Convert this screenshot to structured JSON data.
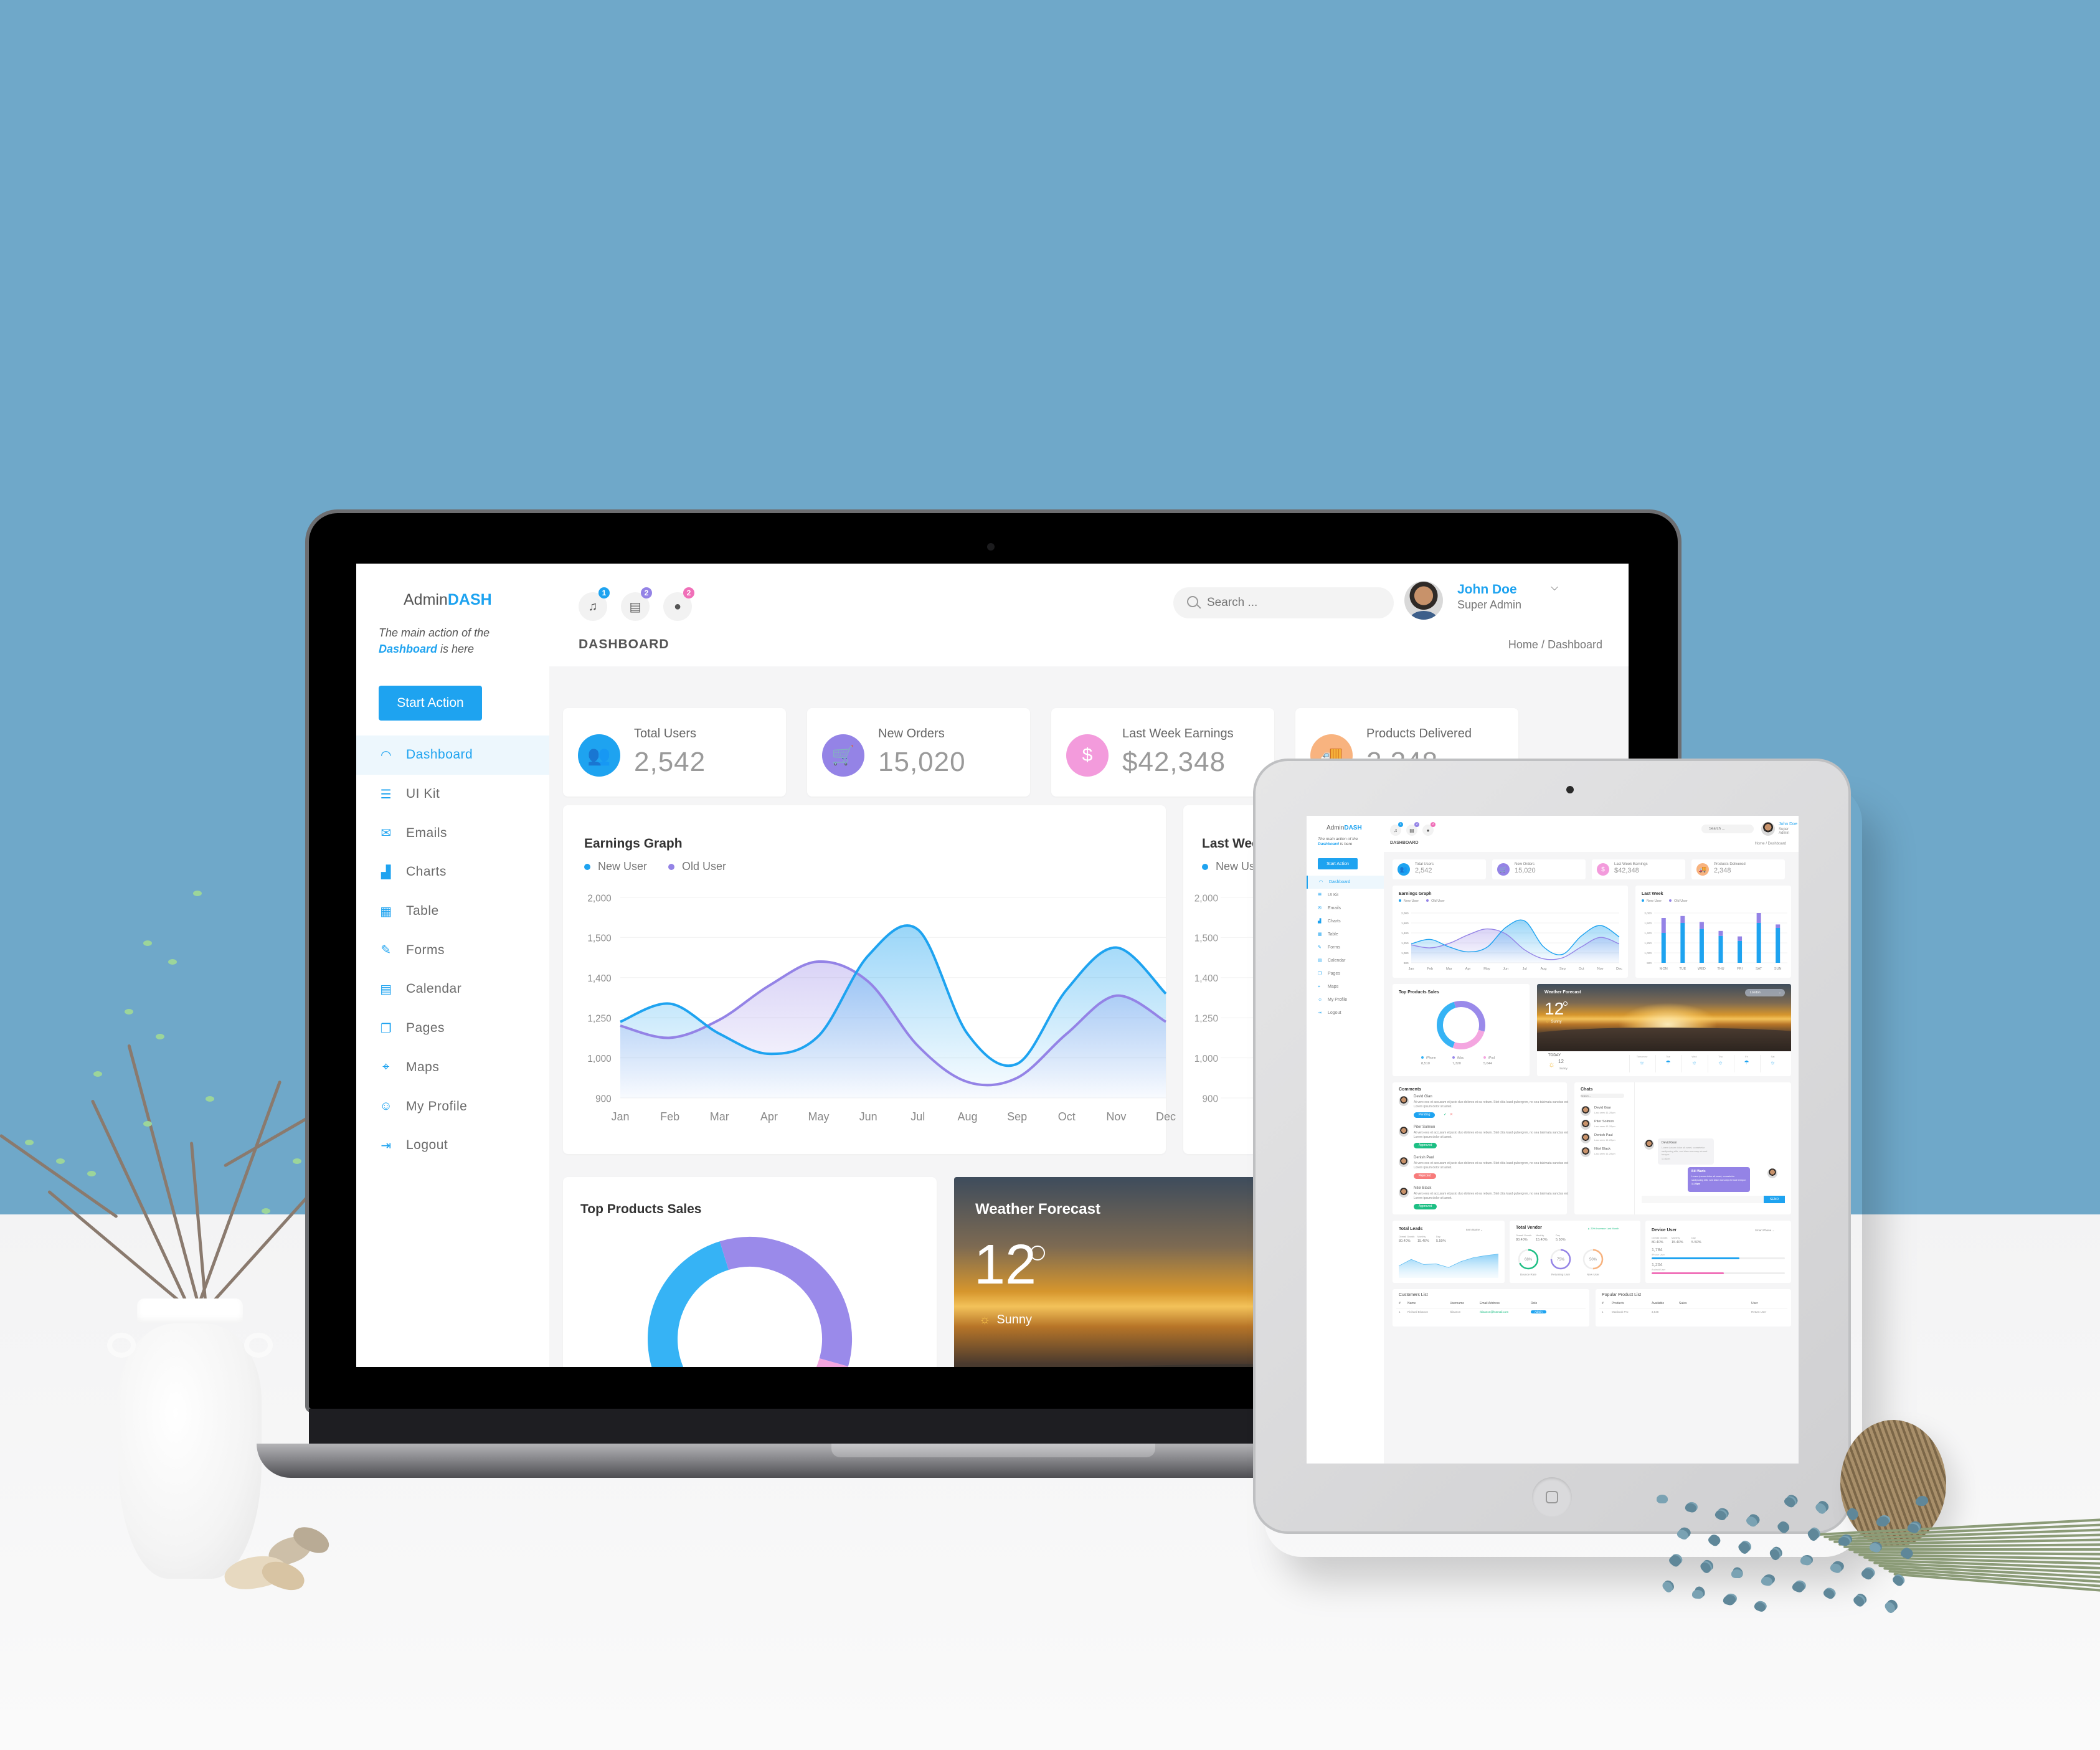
{
  "colors": {
    "accent": "#1ea3f0",
    "purple": "#9483e6",
    "pink": "#f39bdc",
    "orange": "#f8b37f",
    "green": "#1dbf84",
    "red": "#f77b7b",
    "wall": "#6fa8c9"
  },
  "app": {
    "logo_prefix": "Admin",
    "logo_suffix": "DASH",
    "tagline_part1": "The main action of the",
    "tagline_highlight": "Dashboard",
    "tagline_part2": " is here",
    "start_action_label": "Start Action"
  },
  "sidebar": {
    "items": [
      {
        "label": "Dashboard",
        "icon": "speedometer-icon",
        "glyph": "◠",
        "active": true
      },
      {
        "label": "UI Kit",
        "icon": "list-icon",
        "glyph": "☰"
      },
      {
        "label": "Emails",
        "icon": "envelope-icon",
        "glyph": "✉"
      },
      {
        "label": "Charts",
        "icon": "bar-chart-icon",
        "glyph": "▟"
      },
      {
        "label": "Table",
        "icon": "table-icon",
        "glyph": "▦"
      },
      {
        "label": "Forms",
        "icon": "form-edit-icon",
        "glyph": "✎"
      },
      {
        "label": "Calendar",
        "icon": "calendar-icon",
        "glyph": "▤"
      },
      {
        "label": "Pages",
        "icon": "page-icon",
        "glyph": "❐"
      },
      {
        "label": "Maps",
        "icon": "map-pin-icon",
        "glyph": "⌖"
      },
      {
        "label": "My Profile",
        "icon": "user-icon",
        "glyph": "☺"
      },
      {
        "label": "Logout",
        "icon": "logout-icon",
        "glyph": "⇥"
      }
    ]
  },
  "header": {
    "notifications": [
      {
        "icon": "bell-icon",
        "glyph": "♫",
        "count": "1",
        "color": "#1ea3f0"
      },
      {
        "icon": "message-icon",
        "glyph": "▤",
        "count": "2",
        "color": "#9483e6"
      },
      {
        "icon": "user-request-icon",
        "glyph": "●",
        "count": "2",
        "color": "#f06fb8"
      }
    ],
    "page_title": "DASHBOARD",
    "search_placeholder": "Search ...",
    "user_name": "John Doe",
    "user_role": "Super Admin",
    "breadcrumb": "Home / Dashboard"
  },
  "stats": [
    {
      "label": "Total Users",
      "value": "2,542",
      "icon": "users-icon",
      "glyph": "👥",
      "color": "#1ea3f0"
    },
    {
      "label": "New Orders",
      "value": "15,020",
      "icon": "cart-icon",
      "glyph": "🛒",
      "color": "#9483e6"
    },
    {
      "label": "Last Week Earnings",
      "value": "$42,348",
      "icon": "dollar-icon",
      "glyph": "$",
      "color": "#f39bdc"
    },
    {
      "label": "Products Delivered",
      "value": "2,348",
      "icon": "delivery-truck-icon",
      "glyph": "🚚",
      "color": "#f8b37f"
    }
  ],
  "earnings": {
    "title": "Earnings Graph",
    "legend_new": "New User",
    "legend_old": "Old User"
  },
  "last_week": {
    "title": "Last Week",
    "legend_new": "New User",
    "legend_old": "Old User"
  },
  "top_products": {
    "title": "Top Products Sales",
    "items": [
      {
        "name": "iPhone",
        "value": "8,510",
        "color": "#36b3f5"
      },
      {
        "name": "iMac",
        "value": "7,320",
        "color": "#9a8aea"
      },
      {
        "name": "iPod",
        "value": "5,644",
        "color": "#f4a6e0"
      }
    ]
  },
  "weather": {
    "title": "Weather Forecast",
    "temp": "12",
    "condition": "Sunny",
    "city": "London",
    "today_label": "TODAY",
    "today_temp": "12",
    "today_cond": "Sunny",
    "days": [
      {
        "label": "Tomorrow",
        "icon": "sun-icon",
        "glyph": "☼"
      },
      {
        "label": "Tue",
        "icon": "cloud-rain-icon",
        "glyph": "☂"
      },
      {
        "label": "Wed",
        "icon": "sun-icon",
        "glyph": "☼"
      },
      {
        "label": "Thu",
        "icon": "sun-icon",
        "glyph": "☼"
      },
      {
        "label": "Fri",
        "icon": "cloud-rain-icon",
        "glyph": "☂"
      },
      {
        "label": "Sat",
        "icon": "sun-icon",
        "glyph": "☼"
      }
    ]
  },
  "comments": {
    "title": "Comments",
    "items": [
      {
        "name": "Devid Gian",
        "text": "At vero eos et accusam et justo duo dolores et ea rebum. Stet clita kasd gubergren, no sea takimata sanctus est Lorem ipsum dolor sit amet.",
        "status": "Pending",
        "status_color": "#1ea3f0",
        "actions": true
      },
      {
        "name": "Piter Solmon",
        "text": "At vero eos et accusam et justo duo dolores et ea rebum. Stet clita kasd gubergren, no sea takimata sanctus est Lorem ipsum dolor sit amet.",
        "status": "Approved",
        "status_color": "#1dbf84"
      },
      {
        "name": "Denish Paul",
        "text": "At vero eos et accusam et justo duo dolores et ea rebum. Stet clita kasd gubergren, no sea takimata sanctus est Lorem ipsum dolor sit amet.",
        "status": "Rejected",
        "status_color": "#f77b7b"
      },
      {
        "name": "Nitel Black",
        "text": "At vero eos et accusam et justo duo dolores et ea rebum. Stet clita kasd gubergren, no sea takimata sanctus est Lorem ipsum dolor sit amet.",
        "status": "Approved",
        "status_color": "#1dbf84"
      }
    ]
  },
  "chats": {
    "title": "Chats",
    "search_placeholder": "Search ...",
    "contacts": [
      {
        "name": "Devid Gian",
        "seen": "Last seen 11:28pm"
      },
      {
        "name": "Piter Solmon",
        "seen": "Last seen 11:28pm"
      },
      {
        "name": "Denish Paul",
        "seen": "Last seen 11:28pm"
      },
      {
        "name": "Nitel Black",
        "seen": "Last seen 11:28pm"
      }
    ],
    "messages": [
      {
        "from": "Devid Gian",
        "text": "Lorem ipsum dolor sit amet, consetetur sadipscing elitr, sed diam nonumy eirmod tempor.",
        "time": "11:40pm"
      },
      {
        "from": "Bill Waris",
        "text": "Lorem ipsum dolor sit amet, consetetur sadipscing elitr, sed diam nonumy eirmod tempor.",
        "time": "11:28pm"
      }
    ],
    "send_label": "SEND"
  },
  "total_leads": {
    "title": "Total Leads",
    "dropdown": "Item Name",
    "metrics": [
      {
        "label": "Overall Growth",
        "value": "80.40%"
      },
      {
        "label": "Monthly",
        "value": "15.40%"
      },
      {
        "label": "Day",
        "value": "5.50%"
      }
    ]
  },
  "total_vendor": {
    "title": "Total Vendor",
    "trend": "▲ 20% Increase Last Month",
    "metrics": [
      {
        "label": "Overall Growth",
        "value": "80.40%"
      },
      {
        "label": "Monthly",
        "value": "15.40%"
      },
      {
        "label": "Day",
        "value": "5.50%"
      }
    ],
    "rings": [
      {
        "label": "Bounce Rate",
        "percent": 68,
        "text": "68%",
        "color": "#1dbf84"
      },
      {
        "label": "Returning User",
        "percent": 75,
        "text": "75%",
        "color": "#9483e6"
      },
      {
        "label": "New User",
        "percent": 50,
        "text": "50%",
        "color": "#f8b37f"
      }
    ]
  },
  "device_user": {
    "title": "Device User",
    "dropdown": "Smart Phone",
    "metrics": [
      {
        "label": "Overall Growth",
        "value": "80.40%"
      },
      {
        "label": "Monthly",
        "value": "15.40%"
      },
      {
        "label": "Day",
        "value": "5.50%"
      }
    ],
    "bars": [
      {
        "value": "1,784",
        "label": "iPhone User",
        "fraction": 0.66,
        "color": "#1ea3f0"
      },
      {
        "value": "1,204",
        "label": "Android User",
        "fraction": 0.54,
        "color": "#f06fb8"
      }
    ]
  },
  "customers": {
    "title": "Customers List",
    "columns": [
      "#",
      "Name",
      "Username",
      "Email Address",
      "Role"
    ],
    "rows": [
      [
        "1",
        "Richard Bisanon",
        "rbisanon",
        "rbisanon@hotmail.com",
        "Admin"
      ]
    ]
  },
  "popular_products": {
    "title": "Popular Product List",
    "columns": [
      "#",
      "Products",
      "Available",
      "Sales",
      "User"
    ],
    "rows": [
      [
        "1",
        "Macbook Pro",
        "3,548",
        "",
        "Return User"
      ]
    ]
  },
  "chart_data": [
    {
      "type": "area",
      "title": "Earnings Graph",
      "categories": [
        "Jan",
        "Feb",
        "Mar",
        "Apr",
        "May",
        "Jun",
        "Jul",
        "Aug",
        "Sep",
        "Oct",
        "Nov",
        "Dec"
      ],
      "y_tick_labels": [
        "900",
        "1,000",
        "1,250",
        "1,400",
        "1,500",
        "2,000"
      ],
      "y_note": "tick labels are evenly spaced (non-linear); values below are expressed in tick-index units 0..5",
      "series": [
        {
          "name": "New User",
          "color": "#1ea3f0",
          "values": [
            1.9,
            2.35,
            1.6,
            1.1,
            1.55,
            3.55,
            4.2,
            1.6,
            0.85,
            2.7,
            3.75,
            2.6
          ]
        },
        {
          "name": "Old User",
          "color": "#9483e6",
          "values": [
            1.8,
            1.5,
            1.95,
            2.8,
            3.4,
            2.9,
            1.3,
            0.4,
            0.5,
            1.6,
            2.55,
            1.9
          ]
        }
      ],
      "ylim": [
        0,
        5
      ],
      "legend": "top-left",
      "grid": true
    },
    {
      "type": "bar",
      "title": "Last Week",
      "stacked": true,
      "categories": [
        "MON",
        "TUE",
        "WED",
        "THU",
        "FRI",
        "SAT",
        "SUN"
      ],
      "y_tick_labels": [
        "900",
        "1,000",
        "1,250",
        "1,400",
        "1,500",
        "2,000"
      ],
      "series": [
        {
          "name": "New User",
          "color": "#1ea3f0",
          "values": [
            3.0,
            4.0,
            3.4,
            2.7,
            2.2,
            4.0,
            3.5
          ]
        },
        {
          "name": "Old User",
          "color": "#9483e6",
          "values": [
            1.5,
            0.7,
            0.7,
            0.5,
            0.45,
            1.0,
            0.35
          ]
        }
      ],
      "ylim": [
        0,
        5
      ],
      "legend": "top-left"
    },
    {
      "type": "pie",
      "title": "Top Products Sales",
      "donut": true,
      "labels": [
        "iPhone",
        "iMac",
        "iPod"
      ],
      "values": [
        8510,
        7320,
        5644
      ],
      "colors": [
        "#36b3f5",
        "#9a8aea",
        "#f4a6e0"
      ]
    },
    {
      "type": "area",
      "title": "Total Leads",
      "x": [
        1,
        2,
        3,
        4,
        5,
        6,
        7,
        8,
        9
      ],
      "values": [
        40,
        62,
        45,
        47,
        35,
        55,
        68,
        75,
        80
      ],
      "ylim": [
        0,
        100
      ]
    }
  ]
}
